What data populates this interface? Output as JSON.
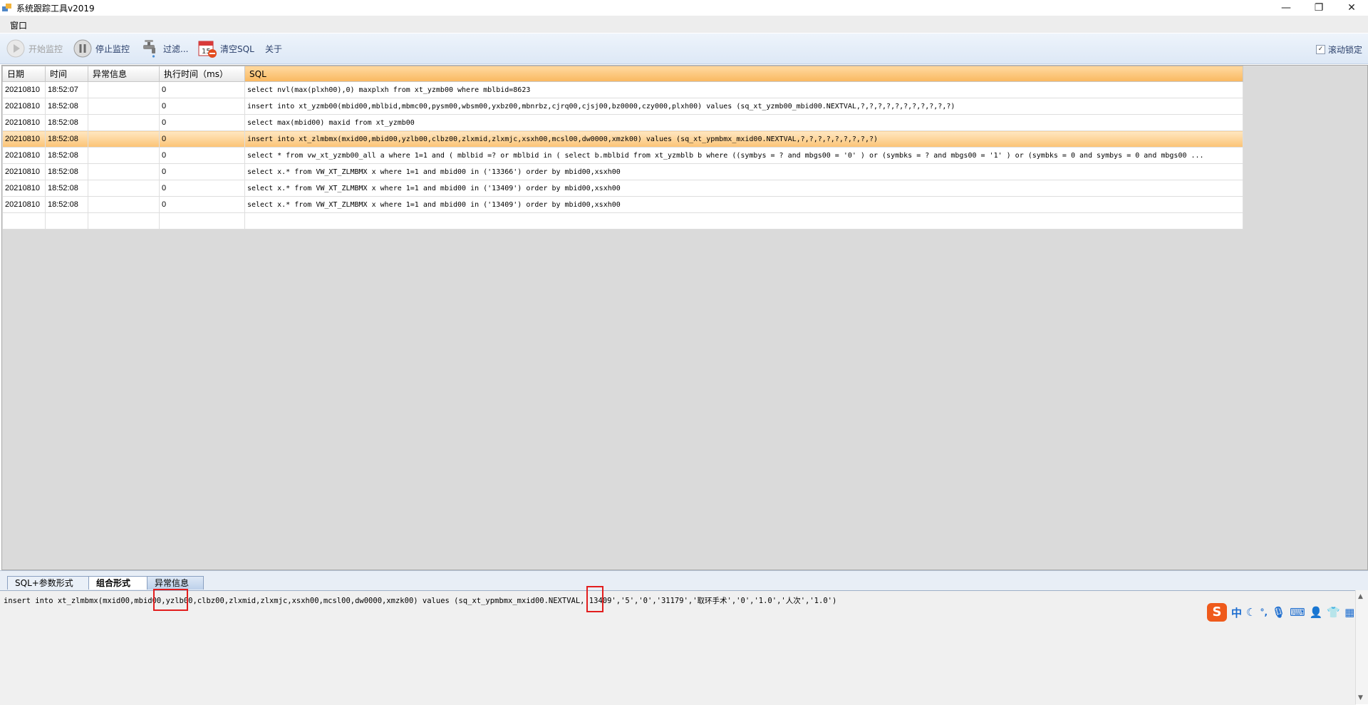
{
  "window": {
    "title": "系统跟踪工具v2019",
    "controls": {
      "minimize": "—",
      "restore": "❐",
      "close": "✕"
    }
  },
  "menu": {
    "items": [
      "窗口"
    ]
  },
  "toolbar": {
    "start_label": "开始监控",
    "stop_label": "停止监控",
    "filter_label": "过滤...",
    "clear_label": "清空SQL",
    "about_label": "关于",
    "scroll_lock_label": "滚动锁定",
    "scroll_lock_checked": true
  },
  "grid": {
    "columns": [
      "日期",
      "时间",
      "异常信息",
      "执行时间（ms）",
      "SQL"
    ],
    "rows": [
      {
        "date": "20210810",
        "time": "18:52:07",
        "error": "",
        "ms": "0",
        "sql": "select nvl(max(plxh00),0) maxplxh from xt_yzmb00 where mblbid=8623"
      },
      {
        "date": "20210810",
        "time": "18:52:08",
        "error": "",
        "ms": "0",
        "sql": "insert into xt_yzmb00(mbid00,mblbid,mbmc00,pysm00,wbsm00,yxbz00,mbnrbz,cjrq00,cjsj00,bz0000,czy000,plxh00) values (sq_xt_yzmb00_mbid00.NEXTVAL,?,?,?,?,?,?,?,?,?,?,?)"
      },
      {
        "date": "20210810",
        "time": "18:52:08",
        "error": "",
        "ms": "0",
        "sql": "select max(mbid00) maxid from xt_yzmb00"
      },
      {
        "date": "20210810",
        "time": "18:52:08",
        "error": "",
        "ms": "0",
        "sql": "insert into xt_zlmbmx(mxid00,mbid00,yzlb00,clbz00,zlxmid,zlxmjc,xsxh00,mcsl00,dw0000,xmzk00) values (sq_xt_ypmbmx_mxid00.NEXTVAL,?,?,?,?,?,?,?,?,?)",
        "selected": true
      },
      {
        "date": "20210810",
        "time": "18:52:08",
        "error": "",
        "ms": "0",
        "sql": "select * from vw_xt_yzmb00_all a where 1=1  and ( mblbid =? or   mblbid in ( select b.mblbid from xt_yzmblb b where ((symbys = ? and mbgs00 = '0' )    or (symbks = ? and mbgs00 = '1' )    or (symbks = 0 and symbys = 0 and mbgs00 ..."
      },
      {
        "date": "20210810",
        "time": "18:52:08",
        "error": "",
        "ms": "0",
        "sql": " select x.* from  VW_XT_ZLMBMX x  where 1=1  and mbid00 in ('13366') order by mbid00,xsxh00"
      },
      {
        "date": "20210810",
        "time": "18:52:08",
        "error": "",
        "ms": "0",
        "sql": " select x.* from  VW_XT_ZLMBMX x  where 1=1  and mbid00 in ('13409') order by mbid00,xsxh00"
      },
      {
        "date": "20210810",
        "time": "18:52:08",
        "error": "",
        "ms": "0",
        "sql": " select x.* from  VW_XT_ZLMBMX x  where 1=1  and mbid00 in ('13409') order by mbid00,xsxh00"
      }
    ]
  },
  "tabs": [
    "SQL+参数形式",
    "组合形式",
    "异常信息"
  ],
  "active_tab": 1,
  "detail": {
    "part1": "insert into xt_zlmbmx(mxid00,mbid00,",
    "hl1": "yzlb00",
    "part2": ",clbz00,zlxmid,zlxmjc,xsxh00,mcsl00,dw0000,xmzk00) values (sq_xt_ypmbmx_mxid00.NEXTVAL,'13409',",
    "hl2": "'5'",
    "part3": ",'0','31179','取环手术','0','1.0','人次','1.0')"
  },
  "ime": {
    "logo": "S",
    "mode": "中",
    "punct": "°,"
  }
}
